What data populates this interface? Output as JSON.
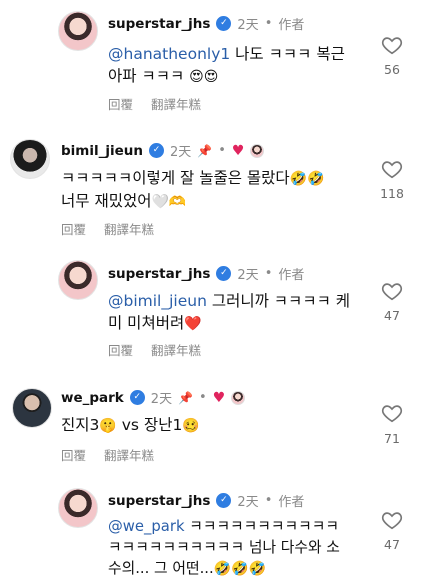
{
  "comments": [
    {
      "username": "superstar_jhs",
      "time": "2天",
      "author_label": "作者",
      "mention": "@hanatheonly1",
      "text_line1": " 나도 ㅋㅋㅋ 복근",
      "text_line2": "아파 ㅋㅋㅋ",
      "emoji": "😍😍",
      "reply_label": "回覆",
      "translate_label": "翻譯年糕",
      "likes": "56"
    },
    {
      "username": "bimil_jieun",
      "time": "2天",
      "text_line1": "ㅋㅋㅋㅋㅋ이렇게 잘 놀줄은 몰랐다",
      "emoji1": "🤣🤣",
      "text_line2": "너무 재밌었어",
      "emoji2": "🤍🫶",
      "reply_label": "回覆",
      "translate_label": "翻譯年糕",
      "likes": "118"
    },
    {
      "username": "superstar_jhs",
      "time": "2天",
      "author_label": "作者",
      "mention": "@bimil_jieun",
      "text_line1": " 그러니까 ㅋㅋㅋㅋ 케",
      "text_line2": "미 미쳐버려",
      "emoji": "❤️",
      "reply_label": "回覆",
      "translate_label": "翻譯年糕",
      "likes": "47"
    },
    {
      "username": "we_park",
      "time": "2天",
      "text_line1a": "진지3",
      "emoji1": "🤫",
      "text_line1b": " vs 장난1",
      "emoji2": "🥴",
      "reply_label": "回覆",
      "translate_label": "翻譯年糕",
      "likes": "71"
    },
    {
      "username": "superstar_jhs",
      "time": "2天",
      "author_label": "作者",
      "mention": "@we_park",
      "text_line1": " ㅋㅋㅋㅋㅋㅋㅋㅋㅋㅋㅋ",
      "text_line2": "ㅋㅋㅋㅋㅋㅋㅋㅋㅋㅋ 넘나 다수와 소",
      "text_line3": "수의... 그 어떤...",
      "emoji": "🤣🤣🤣",
      "likes": "47"
    }
  ],
  "icons": {
    "verified": "verified-badge-icon",
    "like": "heart-outline-icon",
    "pin": "pin-icon",
    "liked_by_author": "red-heart-icon"
  },
  "colors": {
    "verified": "#2f7de1",
    "mention": "#2a5ea8",
    "red_heart": "#e0245e",
    "meta": "#8a8a8a"
  }
}
